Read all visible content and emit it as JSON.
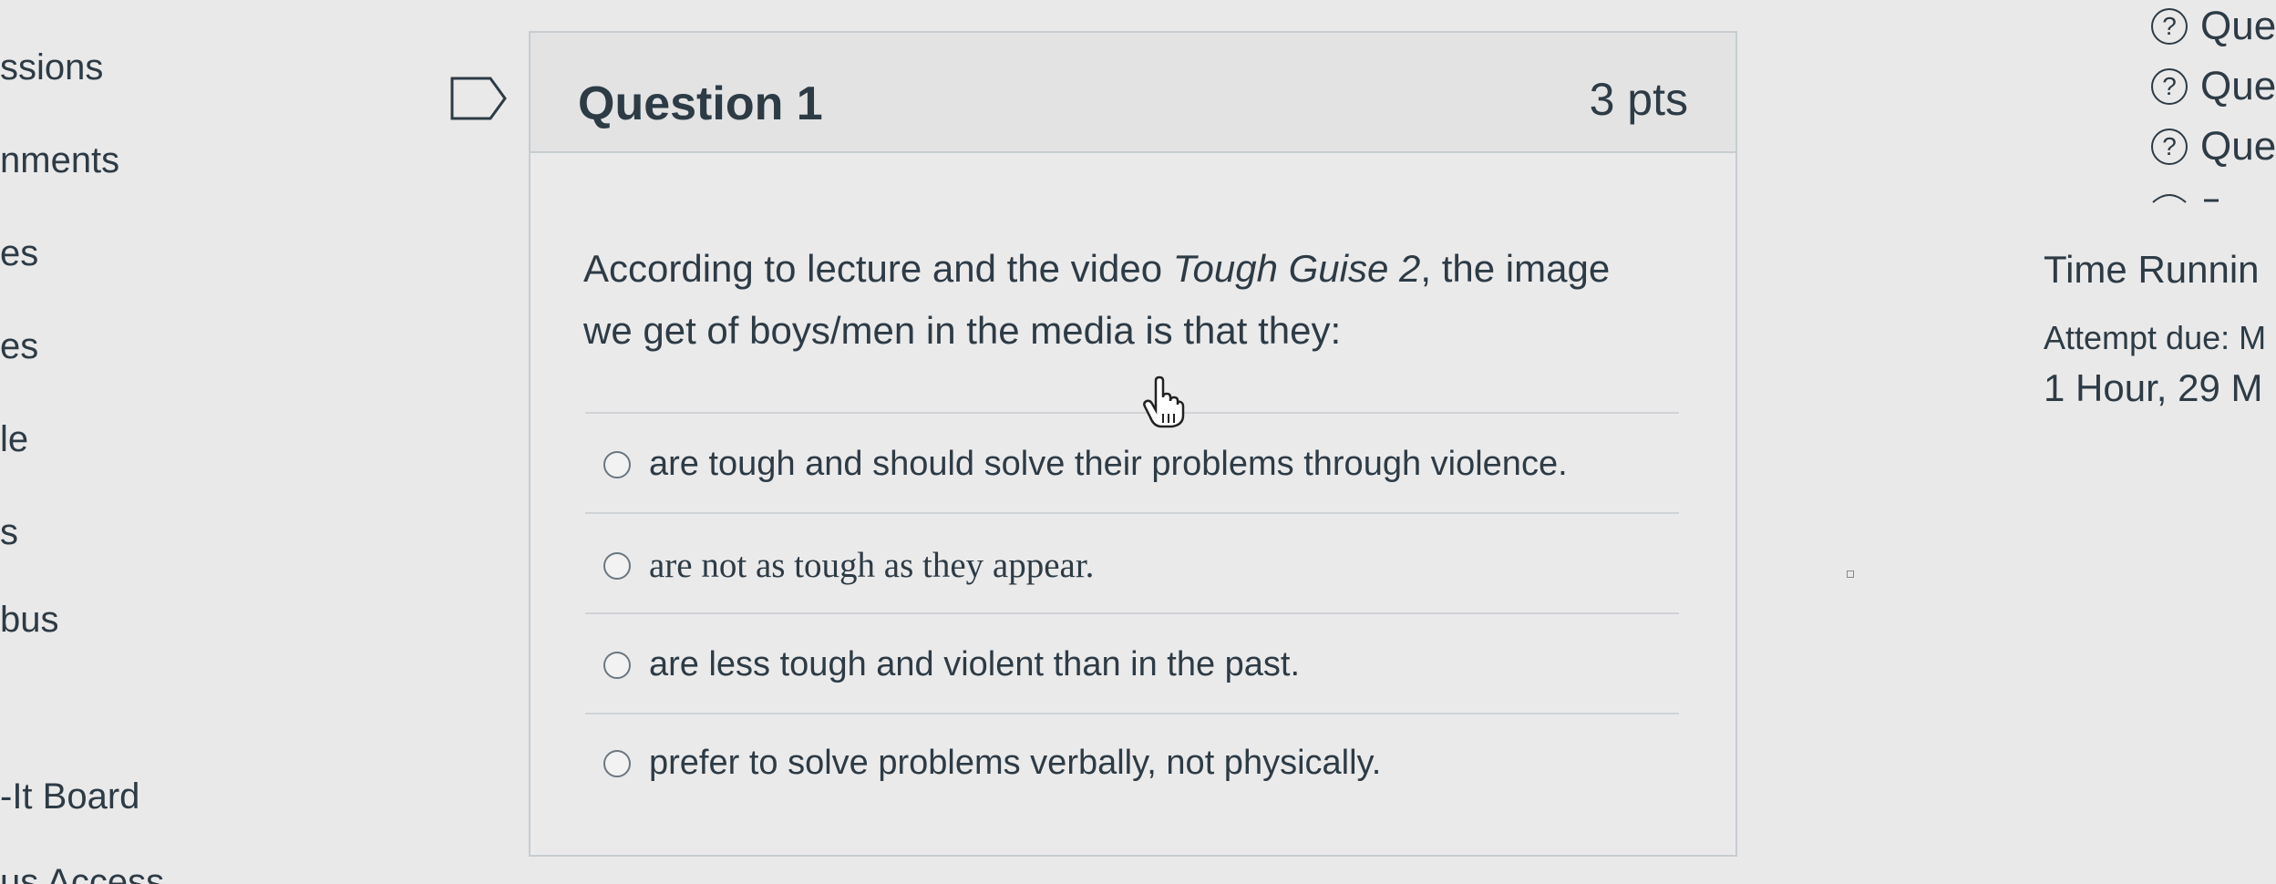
{
  "left_nav": {
    "items": [
      {
        "label": "ssions"
      },
      {
        "label": "nments"
      },
      {
        "label": "es"
      },
      {
        "label": "es"
      },
      {
        "label": "le"
      },
      {
        "label": "s"
      },
      {
        "label": "bus"
      },
      {
        "label": "-It Board"
      },
      {
        "label": "us Access"
      }
    ]
  },
  "question": {
    "title": "Question 1",
    "points": "3 pts",
    "text_before": "According to lecture and the video ",
    "text_italic": "Tough Guise 2",
    "text_after": ", the image we get of boys/men in the media is that they:",
    "answers": [
      {
        "label": "are tough and should solve their problems through violence.",
        "selected": false
      },
      {
        "label": "are not as tough as they appear.",
        "selected": false
      },
      {
        "label": "are less tough and violent than in the past.",
        "selected": false
      },
      {
        "label": "prefer to solve problems verbally, not physically.",
        "selected": false
      }
    ]
  },
  "sidebar": {
    "question_links": [
      {
        "label": "Que",
        "icon": "help-circle-icon"
      },
      {
        "label": "Que",
        "icon": "help-circle-icon"
      },
      {
        "label": "Que",
        "icon": "help-circle-icon"
      }
    ],
    "time_label": "Time Runnin",
    "attempt_due": "Attempt due: M",
    "time_remaining": "1 Hour, 29 M"
  },
  "icons": {
    "flag": "bookmark-flag-icon",
    "cursor": "hand-pointer-icon",
    "help": "?"
  },
  "colors": {
    "text": "#2d3b45",
    "border": "#c7cdd1",
    "background": "#eae9ea"
  }
}
